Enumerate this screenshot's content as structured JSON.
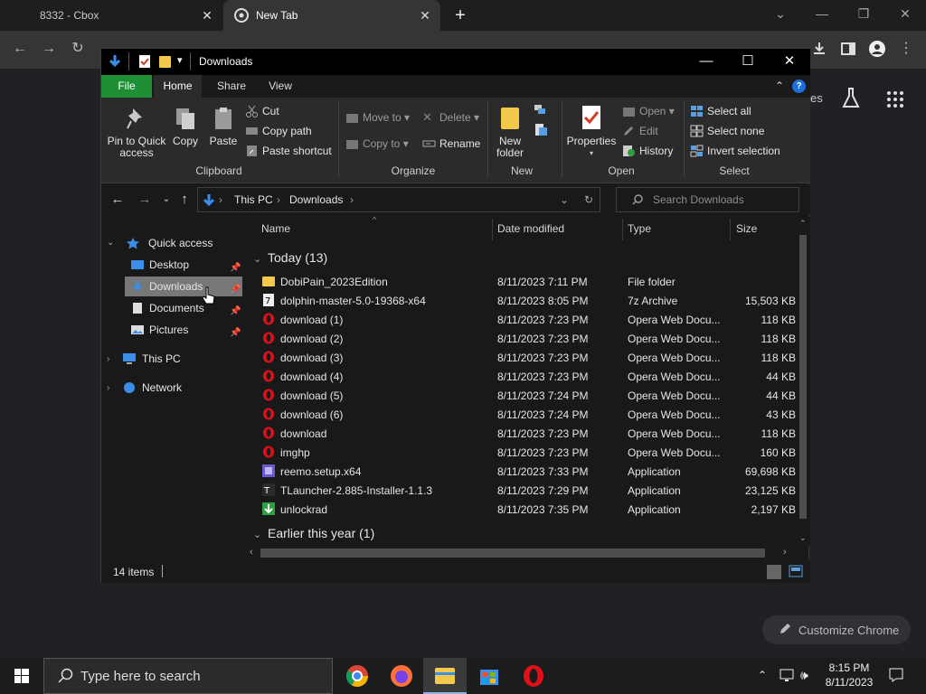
{
  "browser": {
    "tabs": [
      {
        "label": "8332 - Cbox",
        "active": false
      },
      {
        "label": "New Tab",
        "active": true
      }
    ],
    "new_tab_symbol": "+",
    "customize_label": "Customize Chrome",
    "partial_text": "es"
  },
  "explorer": {
    "title": "Downloads",
    "ribbon_tabs": [
      "File",
      "Home",
      "Share",
      "View"
    ],
    "clipboard": {
      "pin_label": "Pin to Quick access",
      "copy_label": "Copy",
      "paste_label": "Paste",
      "cut_label": "Cut",
      "copy_path_label": "Copy path",
      "paste_shortcut_label": "Paste shortcut",
      "group_label": "Clipboard"
    },
    "organize": {
      "move_to_label": "Move to",
      "copy_to_label": "Copy to",
      "delete_label": "Delete",
      "rename_label": "Rename",
      "group_label": "Organize"
    },
    "new_group": {
      "new_folder_label": "New folder",
      "group_label": "New"
    },
    "open_group": {
      "properties_label": "Properties",
      "open_label": "Open",
      "edit_label": "Edit",
      "history_label": "History",
      "group_label": "Open"
    },
    "select_group": {
      "select_all_label": "Select all",
      "select_none_label": "Select none",
      "invert_label": "Invert selection",
      "group_label": "Select"
    },
    "breadcrumbs": [
      "This PC",
      "Downloads"
    ],
    "search_placeholder": "Search Downloads",
    "nav": {
      "quick_access": "Quick access",
      "desktop": "Desktop",
      "downloads": "Downloads",
      "documents": "Documents",
      "pictures": "Pictures",
      "this_pc": "This PC",
      "network": "Network"
    },
    "columns": {
      "name": "Name",
      "date": "Date modified",
      "type": "Type",
      "size": "Size"
    },
    "groups": {
      "today": "Today (13)",
      "earlier": "Earlier this year (1)"
    },
    "files": [
      {
        "name": "DobiPain_2023Edition",
        "date": "8/11/2023 7:11 PM",
        "type": "File folder",
        "size": "",
        "icon": "folder-icon"
      },
      {
        "name": "dolphin-master-5.0-19368-x64",
        "date": "8/11/2023 8:05 PM",
        "type": "7z Archive",
        "size": "15,503 KB",
        "icon": "archive-icon"
      },
      {
        "name": "download (1)",
        "date": "8/11/2023 7:23 PM",
        "type": "Opera Web Docu...",
        "size": "118 KB",
        "icon": "opera-icon"
      },
      {
        "name": "download (2)",
        "date": "8/11/2023 7:23 PM",
        "type": "Opera Web Docu...",
        "size": "118 KB",
        "icon": "opera-icon"
      },
      {
        "name": "download (3)",
        "date": "8/11/2023 7:23 PM",
        "type": "Opera Web Docu...",
        "size": "118 KB",
        "icon": "opera-icon"
      },
      {
        "name": "download (4)",
        "date": "8/11/2023 7:23 PM",
        "type": "Opera Web Docu...",
        "size": "44 KB",
        "icon": "opera-icon"
      },
      {
        "name": "download (5)",
        "date": "8/11/2023 7:24 PM",
        "type": "Opera Web Docu...",
        "size": "44 KB",
        "icon": "opera-icon"
      },
      {
        "name": "download (6)",
        "date": "8/11/2023 7:24 PM",
        "type": "Opera Web Docu...",
        "size": "43 KB",
        "icon": "opera-icon"
      },
      {
        "name": "download",
        "date": "8/11/2023 7:23 PM",
        "type": "Opera Web Docu...",
        "size": "118 KB",
        "icon": "opera-icon"
      },
      {
        "name": "imghp",
        "date": "8/11/2023 7:23 PM",
        "type": "Opera Web Docu...",
        "size": "160 KB",
        "icon": "opera-icon"
      },
      {
        "name": "reemo.setup.x64",
        "date": "8/11/2023 7:33 PM",
        "type": "Application",
        "size": "69,698 KB",
        "icon": "installer-icon"
      },
      {
        "name": "TLauncher-2.885-Installer-1.1.3",
        "date": "8/11/2023 7:29 PM",
        "type": "Application",
        "size": "23,125 KB",
        "icon": "tlauncher-icon"
      },
      {
        "name": "unlockrad",
        "date": "8/11/2023 7:35 PM",
        "type": "Application",
        "size": "2,197 KB",
        "icon": "app-icon"
      }
    ],
    "status_items": "14 items"
  },
  "taskbar": {
    "search_placeholder": "Type here to search",
    "time": "8:15 PM",
    "date": "8/11/2023"
  },
  "colors": {
    "file_tab_green": "#1e8f34",
    "opera_red": "#e0101a",
    "folder_yellow": "#f3c94b",
    "selection_gray": "#777777"
  }
}
